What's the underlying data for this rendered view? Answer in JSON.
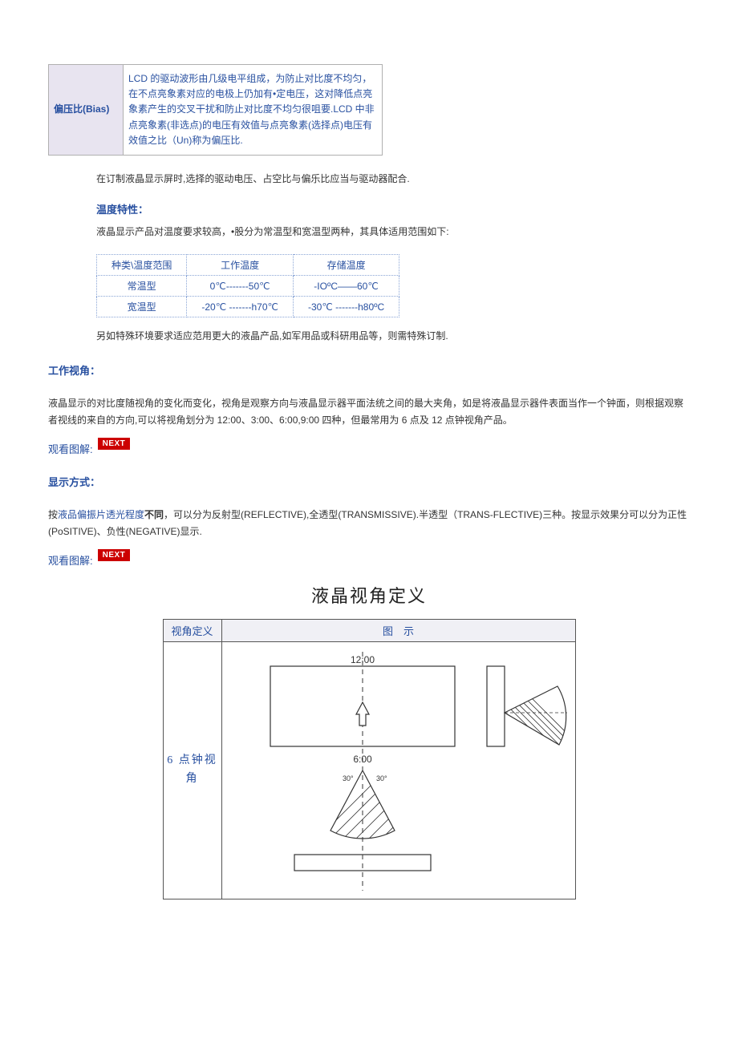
{
  "bias": {
    "label": "偏压比(Bias)",
    "desc": "LCD 的驱动波形由几级电平组成，为防止对比度不均匀，在不点亮象素对应的电极上仍加有•定电压，这对降低点亮象素产生的交叉干扰和防止对比度不均匀很咀要.LCD 中非点亮象素(非选点)的电压有效值与点亮象素(选择点)电压有效值之比（Un)称为偏压比."
  },
  "intro_after_bias": "在订制液晶显示屏时,选择的驱动电压、占空比与偏乐比应当与驱动器配合.",
  "temp_section": {
    "title": "温度特性：",
    "desc": "液晶显示产品对温度要求较高，•股分为常温型和宽温型两种，其具体适用范围如下:",
    "headers": [
      "种类\\温度范围",
      "工作温度",
      "存储温度"
    ],
    "rows": [
      [
        "常温型",
        "0℃-------50℃",
        "-IOºC——60℃"
      ],
      [
        "宽温型",
        "-20℃ -------h70℃",
        "-30℃ -------h80ºC"
      ]
    ],
    "note": "另如特殊环境要求适应范用更大的液晶产品,如军用品或科研用品等，则需特殊订制."
  },
  "angle_section": {
    "title": "工作视角：",
    "desc": "液晶显示的对比度随视角的变化而变化，视角是观察方向与液晶显示器平面法统之间的最大夹角，如是将液晶显示器件表面当作一个钟面，则根据观察者视线的来自的方向,可以将视角划分为 12:00、3:00、6:00,9:00 四种，但最常用为 6 点及 12 点钟视角产品。",
    "view_label": "观看图解:",
    "next": "NEXT"
  },
  "display_section": {
    "title": "显示方式：",
    "desc_prefix": "按",
    "desc_blue": "液品偏振片透光程度",
    "desc_bold": "不同",
    "desc_rest": "，可以分为反射型(REFLECTIVE),全透型(TRANSMISSIVE).半透型（TRANS-FLECTIVE)三种。按显示效果分可以分为正性(PoSITIVE)、负性(NEGATIVE)显示.",
    "view_label": "观看图解:",
    "next": "NEXT"
  },
  "diagram": {
    "heading": "液晶视角定义",
    "col_left_header": "视角定义",
    "col_right_header": "图　示",
    "row_label": "6 点钟视角",
    "top_label": "12:00",
    "bottom_label": "6:00"
  }
}
